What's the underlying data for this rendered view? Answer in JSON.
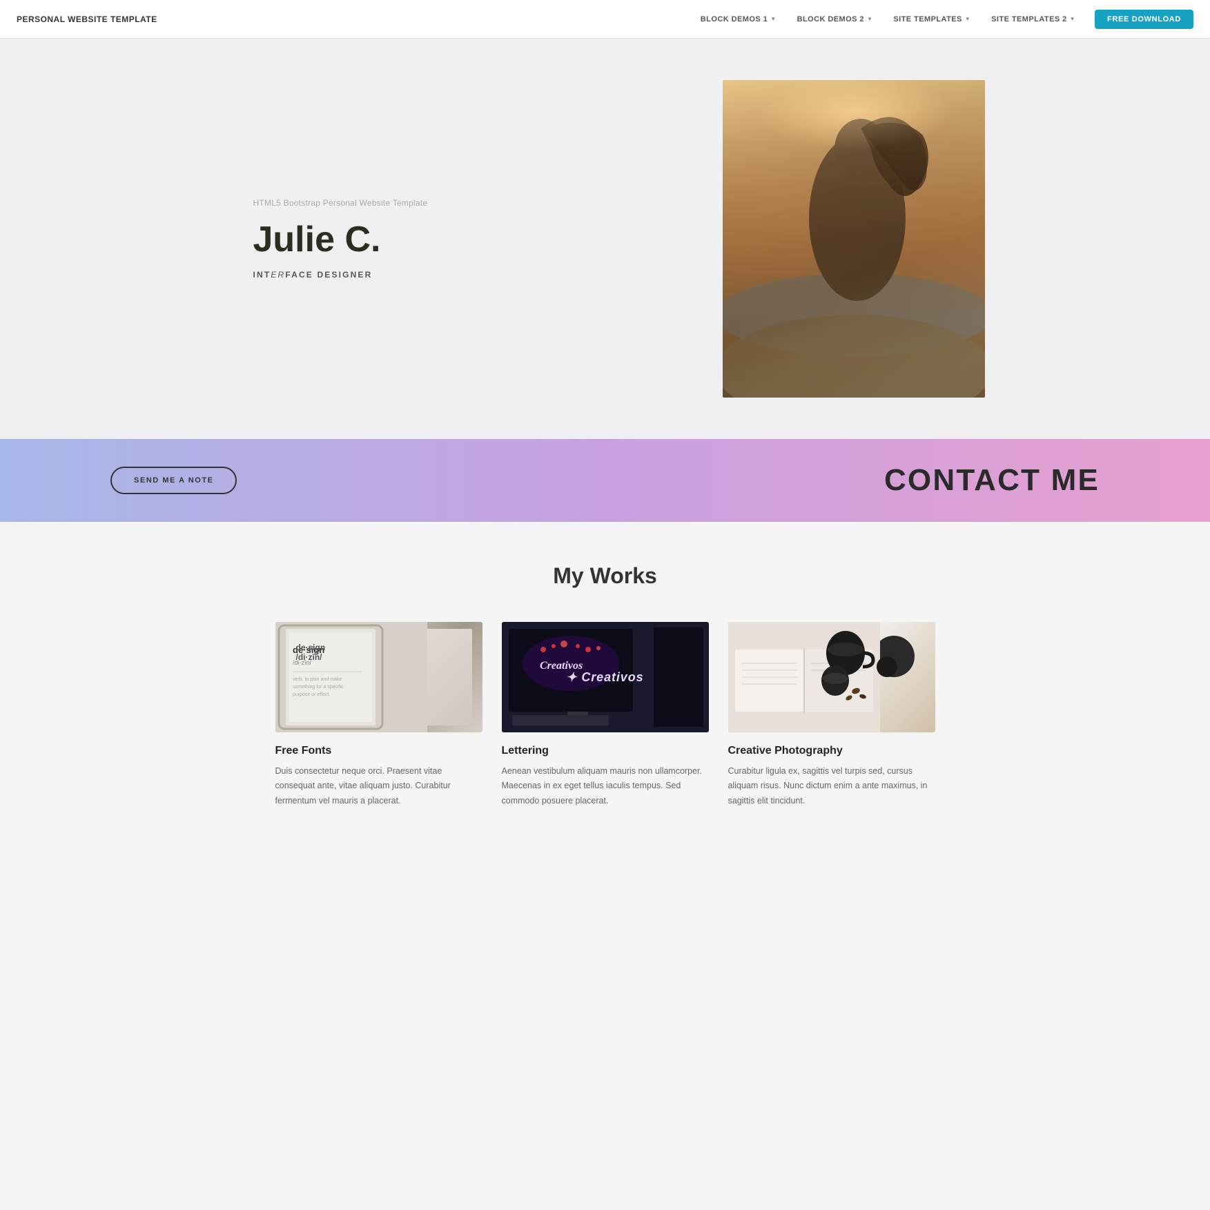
{
  "navbar": {
    "brand": "PERSONAL WEBSITE TEMPLATE",
    "links": [
      {
        "label": "BLOCK DEMOS 1",
        "hasDropdown": true
      },
      {
        "label": "BLOCK DEMOS 2",
        "hasDropdown": true
      },
      {
        "label": "SITE TEMPLATES",
        "hasDropdown": true
      },
      {
        "label": "SITE TEMPLATES 2",
        "hasDropdown": true
      }
    ],
    "download_label": "FREE DOWNLOAD"
  },
  "hero": {
    "subtitle": "HTML5 Bootstrap Personal Website Template",
    "name": "Julie C.",
    "role_prefix": "INT",
    "role_italic": "ER",
    "role_suffix": "FACE DESIGNER"
  },
  "contact": {
    "button_label": "SEND ME A NOTE",
    "title": "CONTACT ME"
  },
  "works": {
    "section_title": "My Works",
    "items": [
      {
        "title": "Free Fonts",
        "description": "Duis consectetur neque orci. Praesent vitae consequat ante, vitae aliquam justo. Curabitur fermentum vel mauris a placerat."
      },
      {
        "title": "Lettering",
        "description": "Aenean vestibulum aliquam mauris non ullamcorper. Maecenas in ex eget tellus iaculis tempus. Sed commodo posuere placerat."
      },
      {
        "title": "Creative Photography",
        "description": "Curabitur ligula ex, sagittis vel turpis sed, cursus aliquam risus. Nunc dictum enim a ante maximus, in sagittis elit tincidunt."
      }
    ]
  }
}
